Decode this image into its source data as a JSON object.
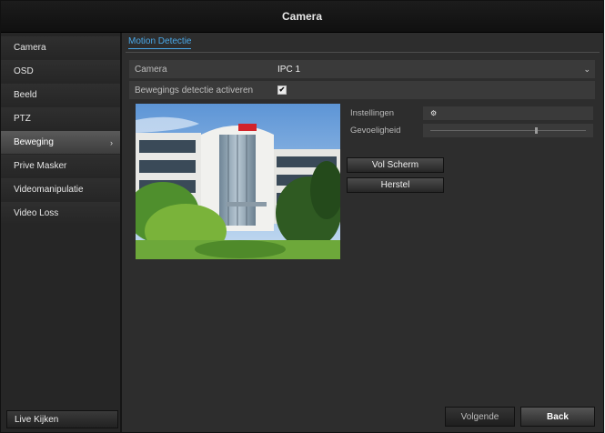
{
  "window": {
    "title": "Camera"
  },
  "sidebar": {
    "items": [
      {
        "label": "Camera"
      },
      {
        "label": "OSD"
      },
      {
        "label": "Beeld"
      },
      {
        "label": "PTZ"
      },
      {
        "label": "Beweging",
        "chevron": "›"
      },
      {
        "label": "Prive Masker"
      },
      {
        "label": "Videomanipulatie"
      },
      {
        "label": "Video Loss"
      }
    ],
    "bottom_button": "Live Kijken"
  },
  "main": {
    "tab": "Motion Detectie",
    "camera_row": {
      "label": "Camera",
      "value": "IPC 1",
      "dropdown": "⌄"
    },
    "enable_row": {
      "label": "Bewegings detectie activeren",
      "checked": "✔"
    },
    "settings": {
      "instellingen_label": "Instellingen",
      "gevoeligheid_label": "Gevoeligheid",
      "gevoeligheid_level": 0.68
    },
    "buttons": {
      "full_screen": "Vol Scherm",
      "reset": "Herstel"
    }
  },
  "footer": {
    "next": "Volgende",
    "back": "Back"
  },
  "colors": {
    "tab_accent": "#4aa8e8",
    "active_item": "#4a4a4a"
  }
}
